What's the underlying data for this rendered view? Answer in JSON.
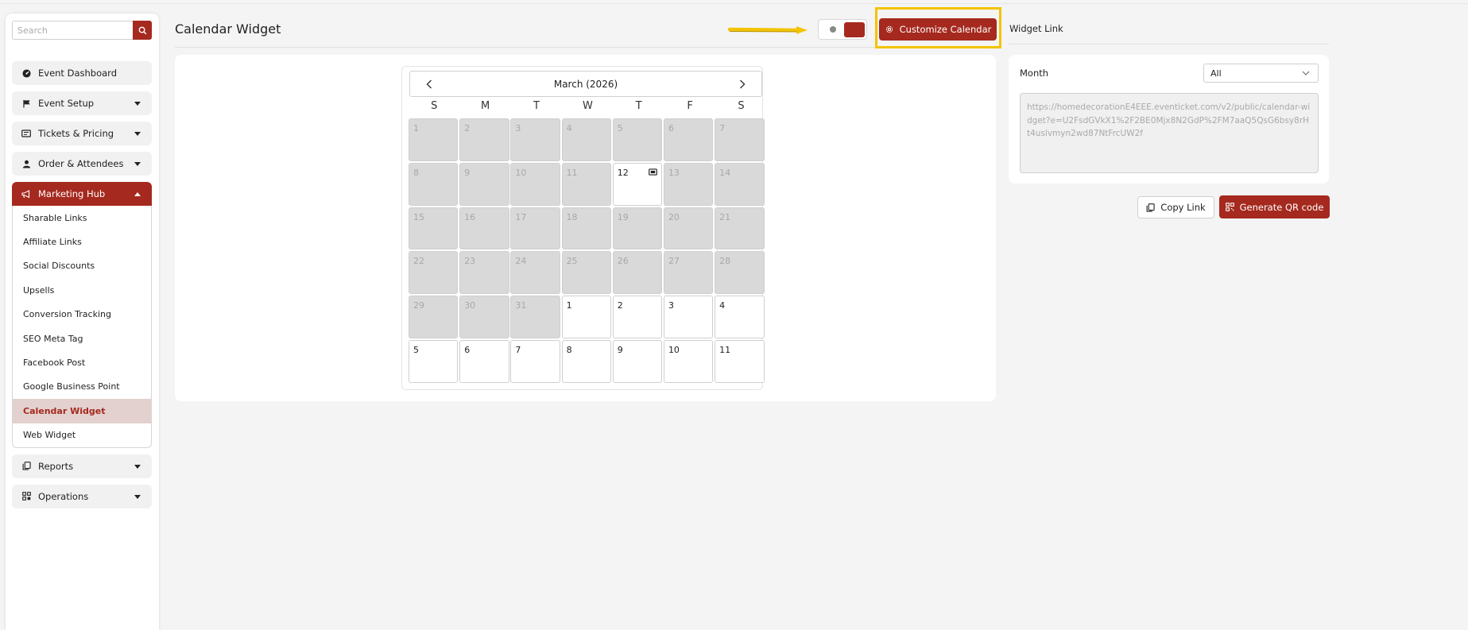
{
  "search": {
    "placeholder": "Search"
  },
  "sidebar": {
    "items": [
      {
        "label": "Event Dashboard",
        "icon": "dashboard-icon"
      },
      {
        "label": "Event Setup",
        "icon": "flag-icon"
      },
      {
        "label": "Tickets & Pricing",
        "icon": "ticket-icon"
      },
      {
        "label": "Order & Attendees",
        "icon": "user-icon"
      },
      {
        "label": "Marketing Hub",
        "icon": "megaphone-icon"
      },
      {
        "label": "Reports",
        "icon": "copy-icon"
      },
      {
        "label": "Operations",
        "icon": "grid-icon"
      }
    ],
    "submenu": [
      "Sharable Links",
      "Affiliate Links",
      "Social Discounts",
      "Upsells",
      "Conversion Tracking",
      "SEO Meta Tag",
      "Facebook Post",
      "Google Business Point",
      "Calendar Widget",
      "Web Widget"
    ],
    "selected_submenu": "Calendar Widget"
  },
  "header": {
    "title": "Calendar Widget",
    "customize_label": "Customize Calendar",
    "widget_link_title": "Widget Link"
  },
  "calendar": {
    "month_label": "March (2026)",
    "weekdays": [
      "S",
      "M",
      "T",
      "W",
      "T",
      "F",
      "S"
    ],
    "days": [
      "1",
      "2",
      "3",
      "4",
      "5",
      "6",
      "7",
      "8",
      "9",
      "10",
      "11",
      "12",
      "13",
      "14",
      "15",
      "16",
      "17",
      "18",
      "19",
      "20",
      "21",
      "22",
      "23",
      "24",
      "25",
      "26",
      "27",
      "28",
      "29",
      "30",
      "31",
      "1",
      "2",
      "3",
      "4",
      "5",
      "6",
      "7",
      "8",
      "9",
      "10",
      "11"
    ],
    "past_count": 31,
    "active_index": 11
  },
  "panel": {
    "month_label": "Month",
    "month_value": "All",
    "link": "https://homedecorationE4EEE.eventicket.com/v2/public/calendar-widget?e=U2FsdGVkX1%2F2BE0Mjx8N2GdP%2FM7aaQ5QsG6bsy8rHt4uslvmyn2wd87NtFrcUW2f"
  },
  "actions": {
    "copy_label": "Copy Link",
    "qr_label": "Generate QR code"
  },
  "colors": {
    "brand": "#a5291e",
    "highlight": "#f3c300",
    "selected_bg": "#e3d1cf"
  }
}
